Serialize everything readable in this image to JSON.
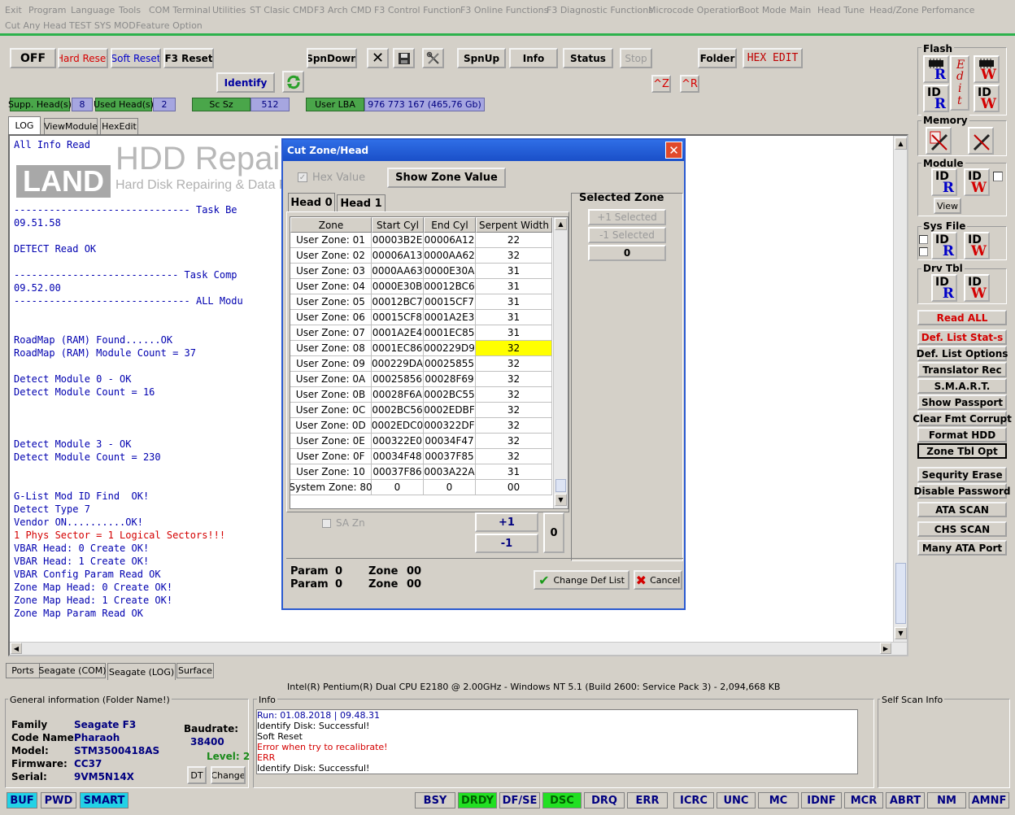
{
  "menu": {
    "row1": [
      "Exit",
      "Program",
      "Language",
      "Tools",
      "COM Terminal",
      "Utilities",
      "ST Clasic CMD",
      "F3 Arch CMD",
      "F3 Control Function",
      "F3 Online Functions",
      "F3 Diagnostic Functions",
      "Microcode Operation",
      "Boot Mode",
      "Main",
      "Head Tune",
      "Head/Zone Perfomance"
    ],
    "row2": [
      "Cut Any Head",
      "TEST SYS MOD",
      "Feature Option"
    ]
  },
  "toolbar": {
    "off": "OFF",
    "hard_reset": "Hard Reset",
    "soft_reset": "Soft Reset",
    "f3_reset": "F3 Reset",
    "spndown": "SpnDown",
    "spnup": "SpnUp",
    "info": "Info",
    "status": "Status",
    "stop": "Stop",
    "folder": "Folder",
    "hex_edit": "HEX EDIT",
    "identify": "Identify",
    "ctrl_z": "^Z",
    "ctrl_r": "^R"
  },
  "infobar": {
    "supp_heads_label": "Supp. Head(s)",
    "supp_heads": "8",
    "used_heads_label": "Used Head(s)",
    "used_heads": "2",
    "sc_sz_label": "Sc Sz",
    "sc_sz": "512",
    "user_lba_label": "User LBA",
    "user_lba": "976 773 167  (465,76 Gb)"
  },
  "log_tabs": [
    "LOG",
    "ViewModule",
    "HexEdit"
  ],
  "watermark": {
    "brand1": "HDD Repairing",
    "brand2": "LAND",
    "tagline": "Hard Disk Repairing & Data Recovering"
  },
  "log_lines": [
    {
      "text": "All Info Read",
      "color": "blue"
    },
    {
      "text": "",
      "color": "blue"
    },
    {
      "text": "",
      "color": "blue"
    },
    {
      "text": "",
      "color": "blue"
    },
    {
      "text": "",
      "color": "blue"
    },
    {
      "text": "------------------------------ Task Be",
      "color": "blue"
    },
    {
      "text": "09.51.58",
      "color": "blue"
    },
    {
      "text": "",
      "color": "blue"
    },
    {
      "text": "DETECT Read OK",
      "color": "blue"
    },
    {
      "text": "",
      "color": "blue"
    },
    {
      "text": "---------------------------- Task Comp",
      "color": "blue"
    },
    {
      "text": "09.52.00",
      "color": "blue"
    },
    {
      "text": "------------------------------ ALL Modu",
      "color": "blue"
    },
    {
      "text": "",
      "color": "blue"
    },
    {
      "text": "",
      "color": "blue"
    },
    {
      "text": "RoadMap (RAM) Found......OK",
      "color": "blue"
    },
    {
      "text": "RoadMap (RAM) Module Count = 37",
      "color": "blue"
    },
    {
      "text": "",
      "color": "blue"
    },
    {
      "text": "Detect Module 0 - OK",
      "color": "blue"
    },
    {
      "text": "Detect Module Count = 16",
      "color": "blue"
    },
    {
      "text": "",
      "color": "blue"
    },
    {
      "text": "",
      "color": "blue"
    },
    {
      "text": "",
      "color": "blue"
    },
    {
      "text": "Detect Module 3 - OK",
      "color": "blue"
    },
    {
      "text": "Detect Module Count = 230",
      "color": "blue"
    },
    {
      "text": "",
      "color": "blue"
    },
    {
      "text": "",
      "color": "blue"
    },
    {
      "text": "G-List Mod ID Find  OK!",
      "color": "blue"
    },
    {
      "text": "Detect Type 7",
      "color": "blue"
    },
    {
      "text": "Vendor ON..........OK!",
      "color": "blue"
    },
    {
      "text": "1 Phys Sector = 1 Logical Sectors!!!",
      "color": "red"
    },
    {
      "text": "VBAR Head: 0 Create OK!",
      "color": "blue"
    },
    {
      "text": "VBAR Head: 1 Create OK!",
      "color": "blue"
    },
    {
      "text": "VBAR Config Param Read OK",
      "color": "blue"
    },
    {
      "text": "Zone Map Head: 0 Create OK!",
      "color": "blue"
    },
    {
      "text": "Zone Map Head: 1 Create OK!",
      "color": "blue"
    },
    {
      "text": "Zone Map Param Read OK",
      "color": "blue"
    }
  ],
  "dialog": {
    "title": "Cut Zone/Head",
    "hex_value": "Hex Value",
    "show_zone_value": "Show Zone Value",
    "tabs": [
      "Head 0",
      "Head 1"
    ],
    "columns": [
      "Zone",
      "Start Cyl",
      "End Cyl",
      "Serpent Width"
    ],
    "rows": [
      [
        "User Zone: 01",
        "00003B2E",
        "00006A12",
        "22"
      ],
      [
        "User Zone: 02",
        "00006A13",
        "0000AA62",
        "32"
      ],
      [
        "User Zone: 03",
        "0000AA63",
        "0000E30A",
        "31"
      ],
      [
        "User Zone: 04",
        "0000E30B",
        "00012BC6",
        "31"
      ],
      [
        "User Zone: 05",
        "00012BC7",
        "00015CF7",
        "31"
      ],
      [
        "User Zone: 06",
        "00015CF8",
        "0001A2E3",
        "31"
      ],
      [
        "User Zone: 07",
        "0001A2E4",
        "0001EC85",
        "31"
      ],
      [
        "User Zone: 08",
        "0001EC86",
        "000229D9",
        "32"
      ],
      [
        "User Zone: 09",
        "000229DA",
        "00025855",
        "32"
      ],
      [
        "User Zone: 0A",
        "00025856",
        "00028F69",
        "32"
      ],
      [
        "User Zone: 0B",
        "00028F6A",
        "0002BC55",
        "32"
      ],
      [
        "User Zone: 0C",
        "0002BC56",
        "0002EDBF",
        "32"
      ],
      [
        "User Zone: 0D",
        "0002EDC0",
        "000322DF",
        "32"
      ],
      [
        "User Zone: 0E",
        "000322E0",
        "00034F47",
        "32"
      ],
      [
        "User Zone: 0F",
        "00034F48",
        "00037F85",
        "32"
      ],
      [
        "User Zone: 10",
        "00037F86",
        "0003A22A",
        "31"
      ],
      [
        "System Zone: 80",
        "0",
        "0",
        "00"
      ]
    ],
    "highlight_row": 7,
    "selected_zone": {
      "title": "Selected Zone",
      "plus": "+1 Selected",
      "minus": "-1 Selected",
      "value": "0"
    },
    "sa_zn": "SA Zn",
    "plus1": "+1",
    "minus1": "-1",
    "step_value": "0",
    "param_label": "Param",
    "zone_label": "Zone",
    "param1": "0",
    "zone1": "00",
    "param2": "0",
    "zone2": "00",
    "change_def_list": "Change Def List",
    "cancel": "Cancel"
  },
  "right_panel": {
    "flash": "Flash",
    "memory": "Memory",
    "module": "Module",
    "view": "View",
    "sys_file": "Sys File",
    "drv_tbl": "Drv Tbl",
    "id": "ID",
    "buttons": [
      "Read ALL",
      "Def. List Stat-s",
      "Def. List Options",
      "Translator Rec",
      "S.M.A.R.T.",
      "Show Passport",
      "Clear Fmt Corrupt",
      "Format HDD",
      "Zone Tbl Opt",
      "Sequrity Erase",
      "Disable Password",
      "ATA SCAN",
      "CHS SCAN",
      "Many ATA Port"
    ]
  },
  "bottom_tabs": [
    "Ports",
    "Seagate (COM)",
    "Seagate (LOG)",
    "Surface"
  ],
  "cpu_info": "Intel(R) Pentium(R) Dual  CPU  E2180  @ 2.00GHz - Windows NT 5.1 (Build 2600: Service Pack 3) -  2,094,668 KB",
  "general": {
    "title": "General information (Folder Name!)",
    "family_label": "Family",
    "family": "Seagate F3",
    "code_label": "Code Name:",
    "code": "Pharaoh",
    "model_label": "Model:",
    "model": "STM3500418AS",
    "firmware_label": "Firmware:",
    "firmware": "CC37",
    "serial_label": "Serial:",
    "serial": "9VM5N14X",
    "baudrate_label": "Baudrate:",
    "baudrate": "38400",
    "level": "Level: 2",
    "dt": "DT",
    "change": "Change"
  },
  "info": {
    "title": "Info",
    "lines": [
      {
        "text": "Run: 01.08.2018 | 09.48.31",
        "color": "blue"
      },
      {
        "text": "Identify Disk: Successful!",
        "color": "black"
      },
      {
        "text": "Soft Reset",
        "color": "black"
      },
      {
        "text": "Error when try to recalibrate!",
        "color": "red"
      },
      {
        "text": "ERR",
        "color": "red"
      },
      {
        "text": "Identify Disk: Successful!",
        "color": "black"
      }
    ]
  },
  "self_scan": "Self Scan Info",
  "status_bar": [
    "BUF",
    "PWD",
    "SMART",
    "BSY",
    "DRDY",
    "DF/SE",
    "DSC",
    "DRQ",
    "ERR",
    "ICRC",
    "UNC",
    "MC",
    "IDNF",
    "MCR",
    "ABRT",
    "NM",
    "AMNF"
  ]
}
